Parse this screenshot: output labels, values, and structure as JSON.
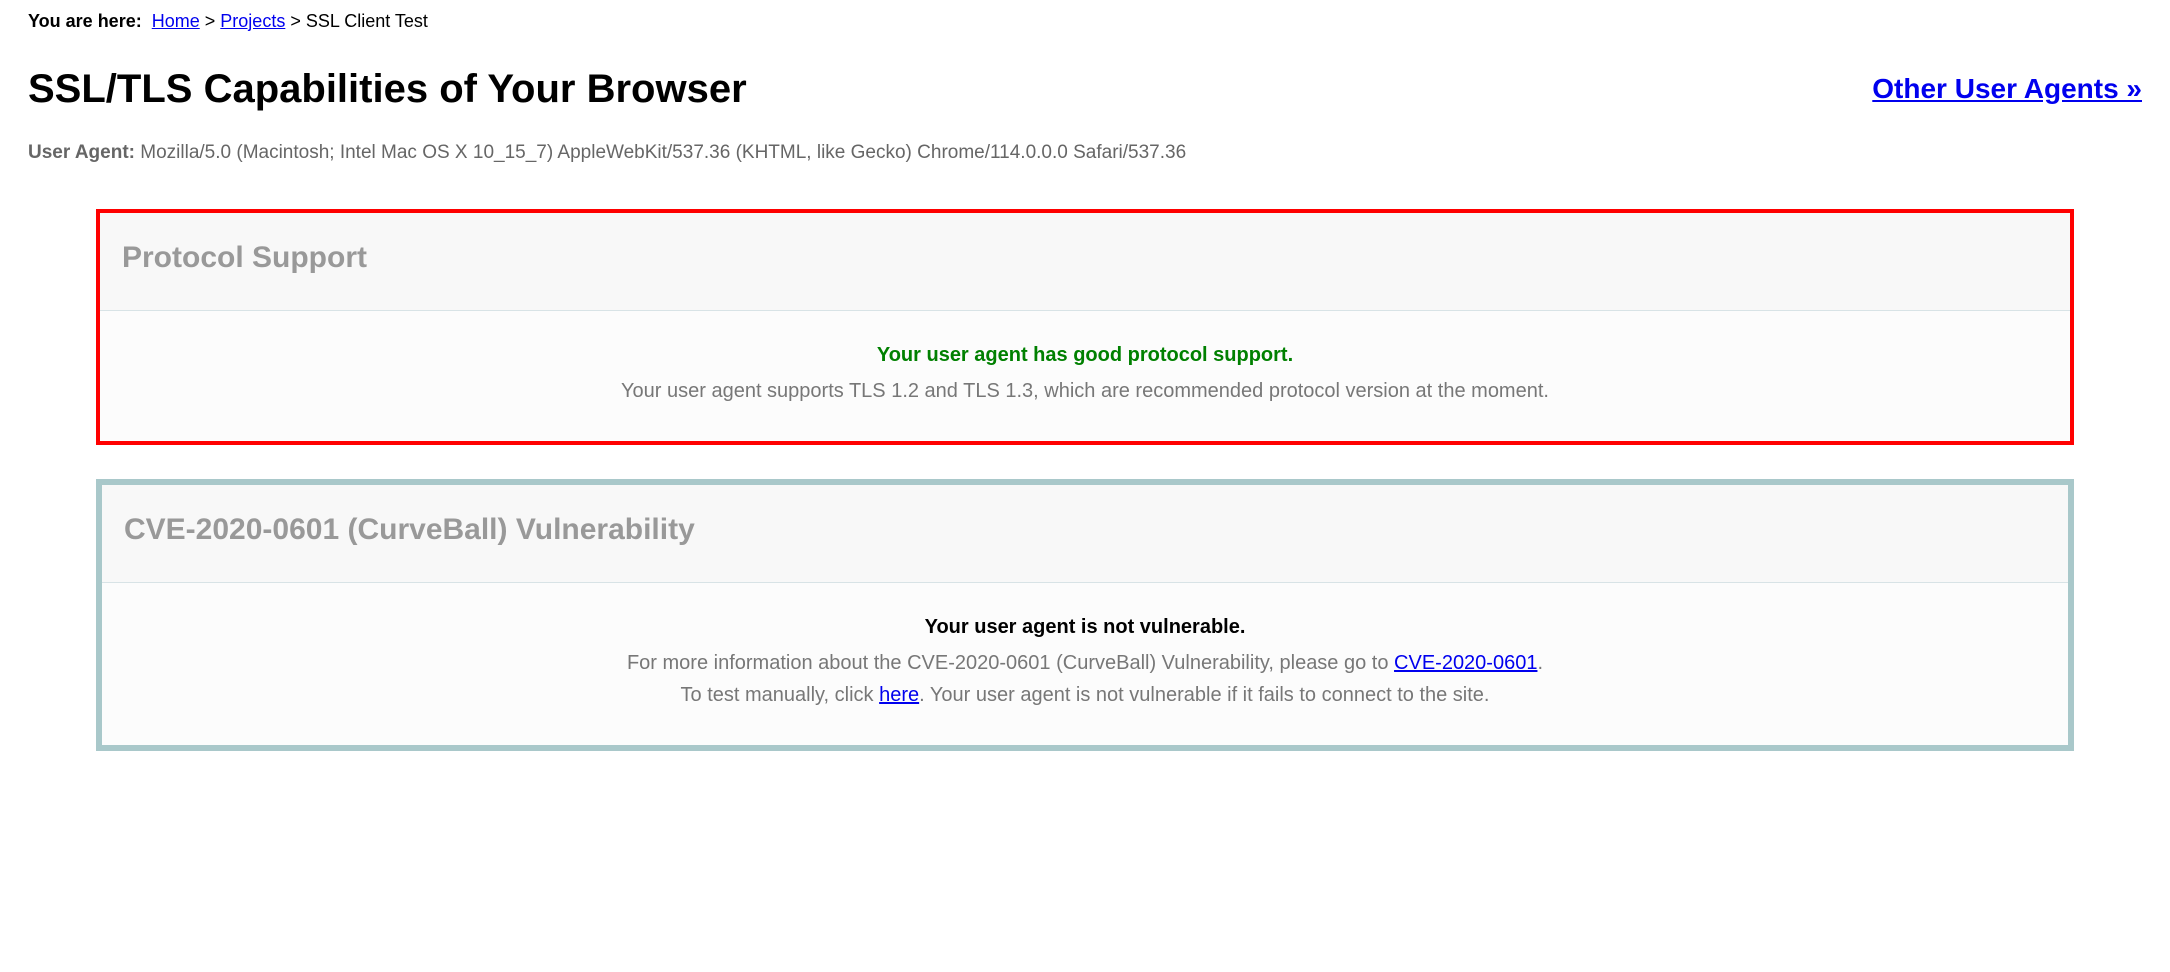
{
  "breadcrumb": {
    "label": "You are here:",
    "home": "Home",
    "sep1": ">",
    "projects": "Projects",
    "sep2": ">",
    "current": "SSL Client Test"
  },
  "header": {
    "title": "SSL/TLS Capabilities of Your Browser",
    "other_ua": "Other User Agents »"
  },
  "user_agent": {
    "key": "User Agent:",
    "value": "Mozilla/5.0 (Macintosh; Intel Mac OS X 10_15_7) AppleWebKit/537.36 (KHTML, like Gecko) Chrome/114.0.0.0 Safari/537.36"
  },
  "protocol_card": {
    "title": "Protocol Support",
    "headline": "Your user agent has good protocol support.",
    "detail": "Your user agent supports TLS 1.2 and TLS 1.3, which are recommended protocol version at the moment."
  },
  "cve_card": {
    "title": "CVE-2020-0601 (CurveBall) Vulnerability",
    "headline": "Your user agent is not vulnerable.",
    "line1_pre": "For more information about the CVE-2020-0601 (CurveBall) Vulnerability, please go to ",
    "line1_link": "CVE-2020-0601",
    "line1_post": ".",
    "line2_pre": "To test manually, click ",
    "line2_link": "here",
    "line2_post": ". Your user agent is not vulnerable if it fails to connect to the site."
  }
}
